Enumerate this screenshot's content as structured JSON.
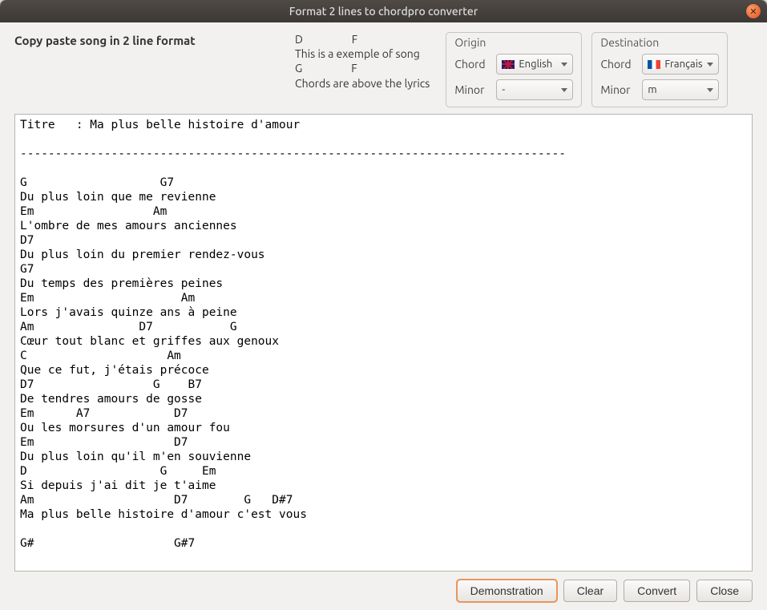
{
  "window": {
    "title": "Format 2 lines to chordpro converter"
  },
  "instruction": "Copy paste song in 2 line format",
  "example": {
    "line1": "D                   F",
    "line2": "This is a exemple of song",
    "line3": "G                   F",
    "line4": "Chords are above the lyrics"
  },
  "origin": {
    "title": "Origin",
    "chord_label": "Chord",
    "chord_value": "English",
    "minor_label": "Minor",
    "minor_value": "-"
  },
  "destination": {
    "title": "Destination",
    "chord_label": "Chord",
    "chord_value": "Français",
    "minor_label": "Minor",
    "minor_value": "m"
  },
  "song_text": "Titre   : Ma plus belle histoire d'amour\n\n------------------------------------------------------------------------------\n\nG                   G7\nDu plus loin que me revienne\nEm                 Am\nL'ombre de mes amours anciennes\nD7\nDu plus loin du premier rendez-vous\nG7\nDu temps des premières peines\nEm                     Am\nLors j'avais quinze ans à peine\nAm               D7           G\nCœur tout blanc et griffes aux genoux\nC                    Am\nQue ce fut, j'étais précoce\nD7                 G    B7\nDe tendres amours de gosse\nEm      A7            D7\nOu les morsures d'un amour fou\nEm                    D7\nDu plus loin qu'il m'en souvienne\nD                   G     Em\nSi depuis j'ai dit je t'aime\nAm                    D7        G   D#7\nMa plus belle histoire d'amour c'est vous\n\nG#                    G#7",
  "buttons": {
    "demonstration": "Demonstration",
    "clear": "Clear",
    "convert": "Convert",
    "close": "Close"
  }
}
